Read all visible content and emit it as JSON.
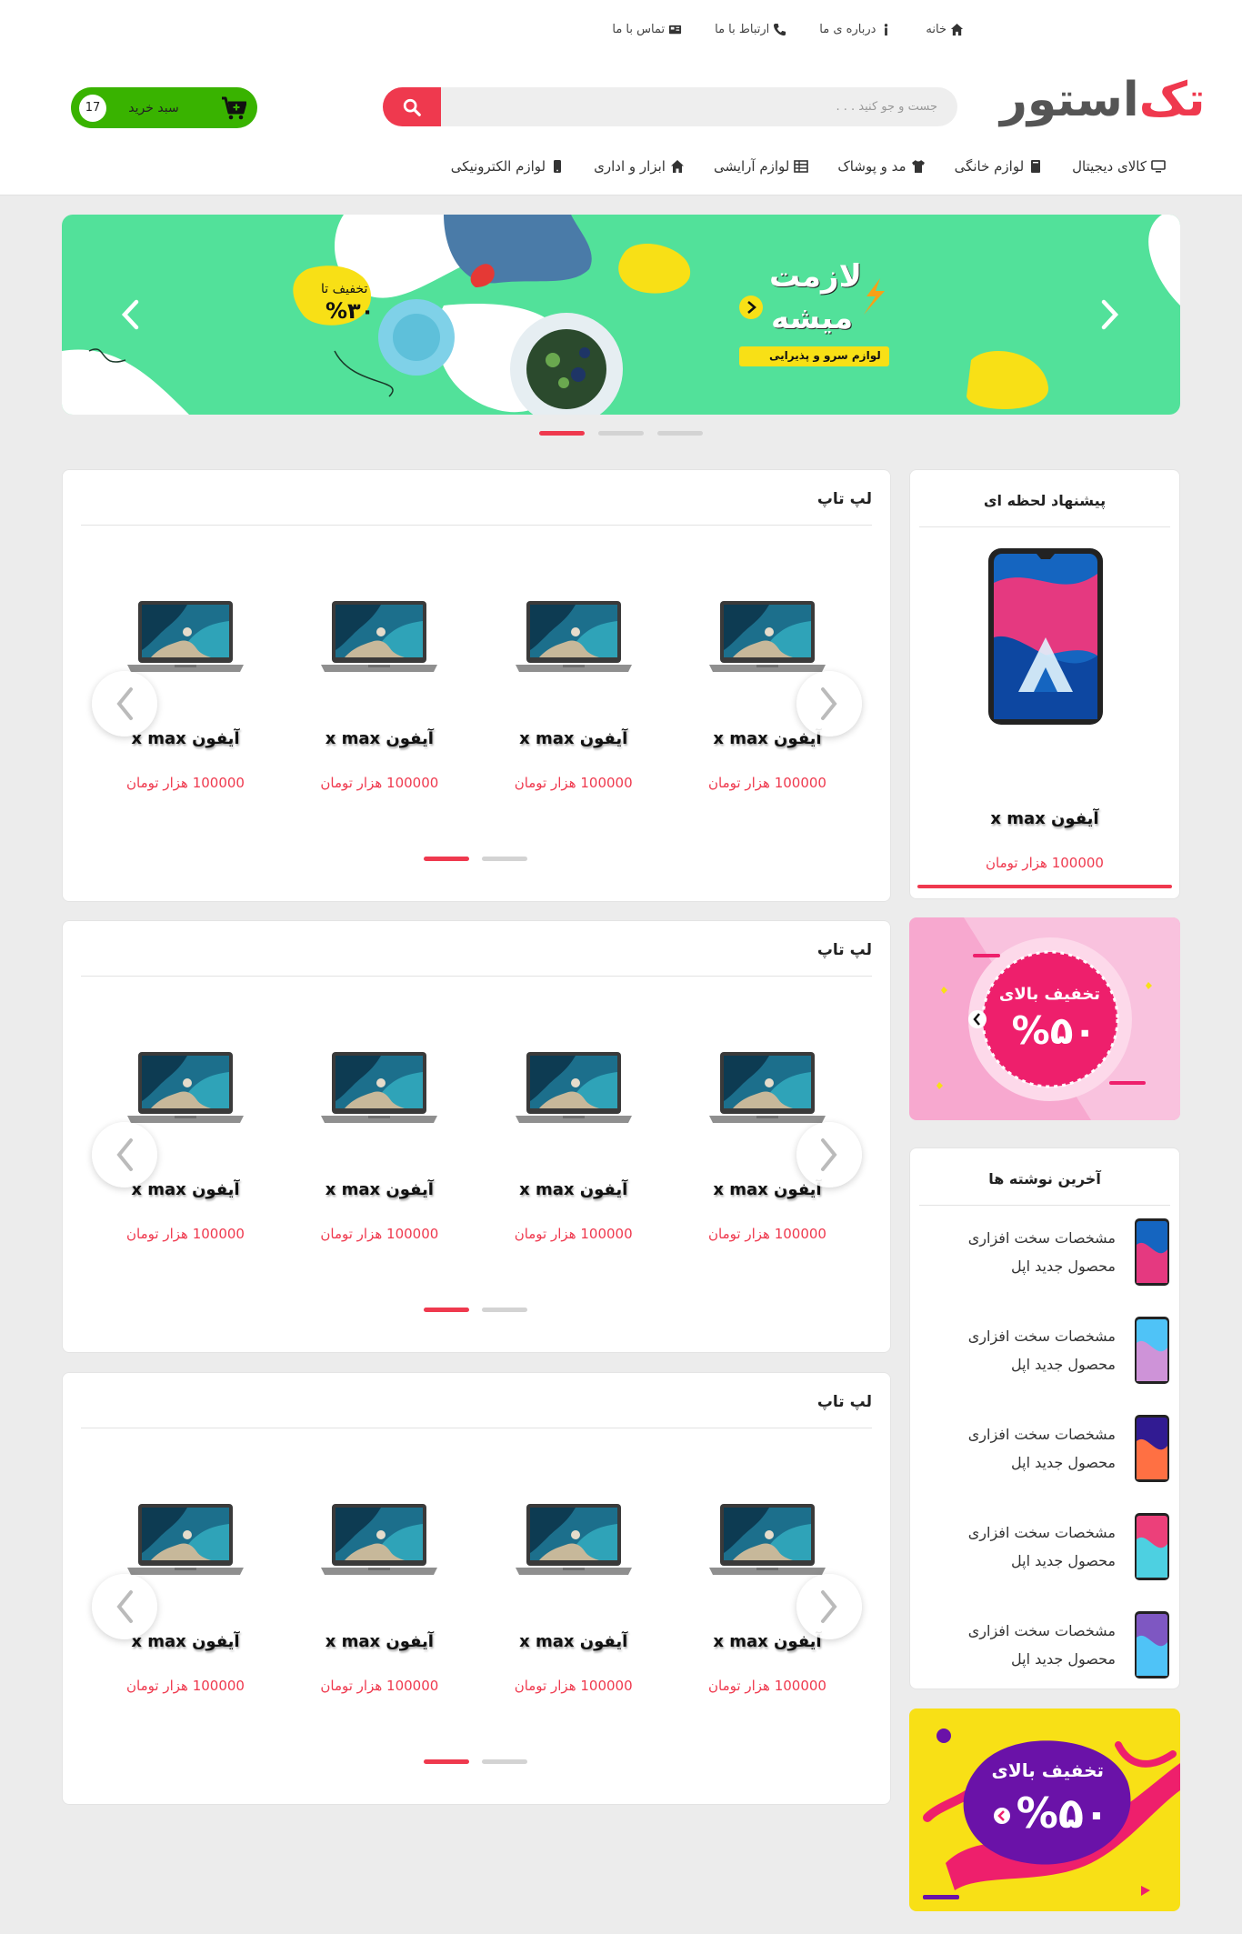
{
  "topnav": [
    {
      "label": "خانه",
      "icon": "home-icon"
    },
    {
      "label": "درباره ی ما",
      "icon": "info-icon"
    },
    {
      "label": "ارتباط با ما",
      "icon": "phone-icon"
    },
    {
      "label": "تماس با ما",
      "icon": "contact-card-icon"
    }
  ],
  "logo": {
    "part1": "تک",
    "part2": "استور"
  },
  "search": {
    "placeholder": "جست و جو کنید . . ."
  },
  "cart": {
    "label": "سبد خرید",
    "count": "17"
  },
  "categories": [
    {
      "label": "کالای دیجیتال",
      "icon": "monitor-icon"
    },
    {
      "label": "لوازم خانگی",
      "icon": "book-icon"
    },
    {
      "label": "مد و پوشاک",
      "icon": "tshirt-icon"
    },
    {
      "label": "لوازم آرایشی",
      "icon": "table-icon"
    },
    {
      "label": "ابزار و اداری",
      "icon": "home-icon"
    },
    {
      "label": "لوازم الکترونیکی",
      "icon": "mobile-icon"
    }
  ],
  "hero": {
    "headline_line1": "لازمت",
    "headline_line2": "میشه",
    "tagline": "لوازم سرو و پذیرایی",
    "discount_label": "تخفیف تا",
    "discount_value": "%۳۰",
    "slides": 3,
    "active_slide": 3
  },
  "product_sections": [
    {
      "title": "لپ تاپ",
      "products": [
        {
          "name": "آیفون x max",
          "price": "100000 هزار تومان"
        },
        {
          "name": "آیفون x max",
          "price": "100000 هزار تومان"
        },
        {
          "name": "آیفون x max",
          "price": "100000 هزار تومان"
        },
        {
          "name": "آیفون x max",
          "price": "100000 هزار تومان"
        }
      ]
    },
    {
      "title": "لپ تاپ",
      "products": [
        {
          "name": "آیفون x max",
          "price": "100000 هزار تومان"
        },
        {
          "name": "آیفون x max",
          "price": "100000 هزار تومان"
        },
        {
          "name": "آیفون x max",
          "price": "100000 هزار تومان"
        },
        {
          "name": "آیفون x max",
          "price": "100000 هزار تومان"
        }
      ]
    },
    {
      "title": "لپ تاپ",
      "products": [
        {
          "name": "آیفون x max",
          "price": "100000 هزار تومان"
        },
        {
          "name": "آیفون x max",
          "price": "100000 هزار تومان"
        },
        {
          "name": "آیفون x max",
          "price": "100000 هزار تومان"
        },
        {
          "name": "آیفون x max",
          "price": "100000 هزار تومان"
        }
      ]
    }
  ],
  "instant_offer": {
    "title": "پیشنهاد لحظه ای",
    "name": "آیفون x max",
    "price": "100000 هزار تومان"
  },
  "banner1": {
    "label": "تخفیف بالای",
    "value": "%۵۰"
  },
  "latest_posts": {
    "title": "آخرین نوشته ها",
    "items": [
      {
        "line1": "مشخصات سخت افزاری",
        "line2": "محصول جدید اپل"
      },
      {
        "line1": "مشخصات سخت افزاری",
        "line2": "محصول جدید اپل"
      },
      {
        "line1": "مشخصات سخت افزاری",
        "line2": "محصول جدید اپل"
      },
      {
        "line1": "مشخصات سخت افزاری",
        "line2": "محصول جدید اپل"
      },
      {
        "line1": "مشخصات سخت افزاری",
        "line2": "محصول جدید اپل"
      }
    ]
  },
  "banner2": {
    "label": "تخفیف بالای",
    "value": "%۵۰"
  },
  "colors": {
    "accent": "#ef394e",
    "cart_green": "#39b300",
    "hero_green": "#52e19a",
    "banner_pink": "#f7a8cf",
    "banner_yellow": "#f8e016",
    "banner_purple": "#6a12a8"
  }
}
